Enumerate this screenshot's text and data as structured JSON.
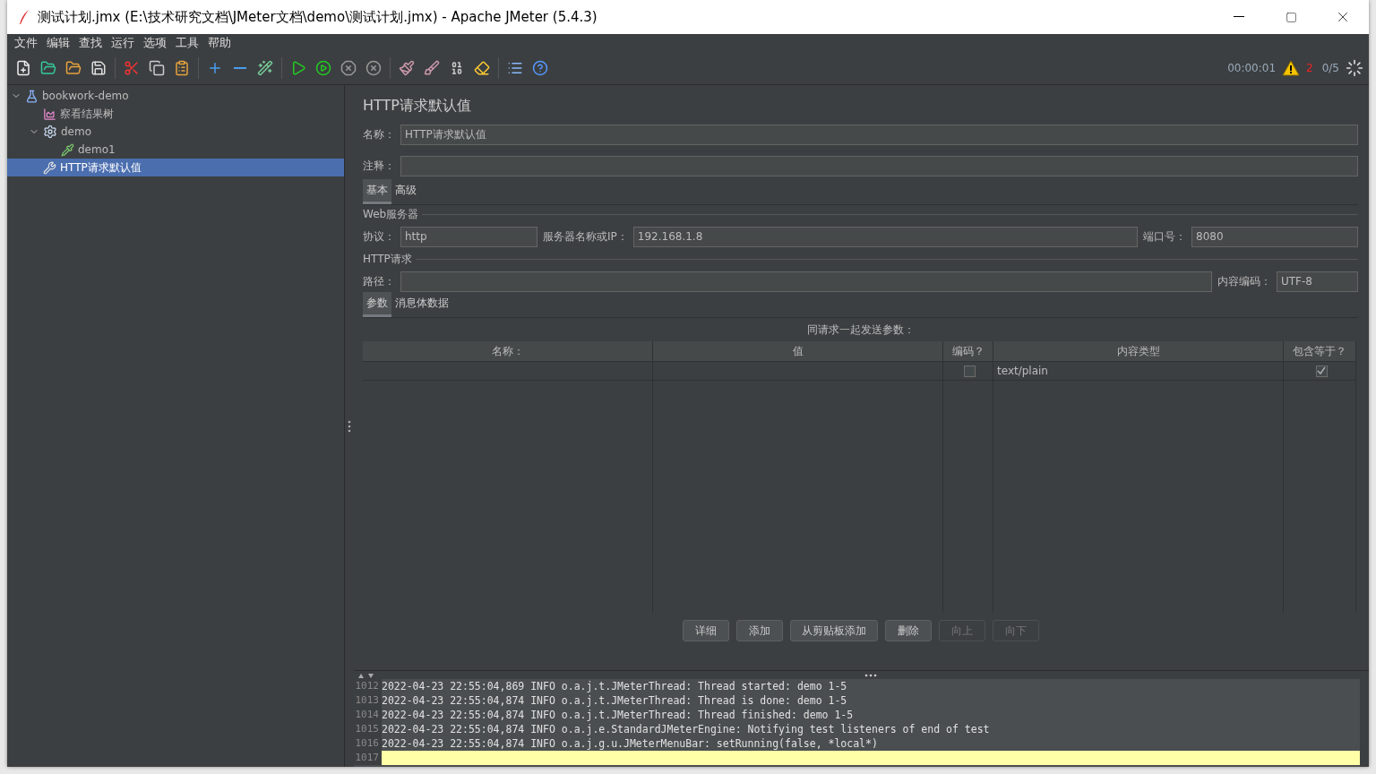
{
  "window": {
    "title": "测试计划.jmx (E:\\技术研究文档\\JMeter文档\\demo\\测试计划.jmx) - Apache JMeter (5.4.3)"
  },
  "menu": [
    "文件",
    "编辑",
    "查找",
    "运行",
    "选项",
    "工具",
    "帮助"
  ],
  "status": {
    "elapsed": "00:00:01",
    "warnings": "2",
    "threads": "0/5"
  },
  "tree": [
    {
      "label": "bookwork-demo",
      "kind": "plan",
      "expanded": true,
      "selected": false,
      "children": [
        {
          "label": "察看结果树",
          "kind": "listener",
          "selected": false
        },
        {
          "label": "demo",
          "kind": "group",
          "expanded": true,
          "selected": false,
          "children": [
            {
              "label": "demo1",
              "kind": "sampler",
              "selected": false
            }
          ]
        },
        {
          "label": "HTTP请求默认值",
          "kind": "config",
          "selected": true
        }
      ]
    }
  ],
  "panel": {
    "title": "HTTP请求默认值",
    "name_label": "名称：",
    "name_value": "HTTP请求默认值",
    "comment_label": "注释：",
    "tabs": [
      {
        "label": "基本",
        "selected": true
      },
      {
        "label": "高级",
        "selected": false
      }
    ],
    "web_server": {
      "legend": "Web服务器",
      "protocol_label": "协议：",
      "protocol": "http",
      "server_label": "服务器名称或IP：",
      "server": "192.168.1.8",
      "port_label": "端口号：",
      "port": "8080"
    },
    "http_request": {
      "legend": "HTTP请求",
      "path_label": "路径：",
      "encoding_label": "内容编码：",
      "encoding": "UTF-8"
    },
    "param_tabs": [
      {
        "label": "参数",
        "selected": true
      },
      {
        "label": "消息体数据",
        "selected": false
      }
    ],
    "table": {
      "caption": "同请求一起发送参数：",
      "columns": [
        "名称：",
        "值",
        "编码？",
        "内容类型",
        "包含等于？"
      ],
      "rows": [
        {
          "encode": false,
          "content_type": "text/plain",
          "include_equals": true
        }
      ]
    },
    "buttons": [
      {
        "label": "详细",
        "disabled": false
      },
      {
        "label": "添加",
        "disabled": false
      },
      {
        "label": "从剪贴板添加",
        "disabled": false
      },
      {
        "label": "删除",
        "disabled": false
      },
      {
        "label": "向上",
        "disabled": true
      },
      {
        "label": "向下",
        "disabled": true
      }
    ]
  },
  "log": [
    {
      "number": "1012",
      "text": "2022-04-23 22:55:04,869 INFO o.a.j.t.JMeterThread: Thread started: demo 1-5",
      "current": false
    },
    {
      "number": "1013",
      "text": "2022-04-23 22:55:04,874 INFO o.a.j.t.JMeterThread: Thread is done: demo 1-5",
      "current": false
    },
    {
      "number": "1014",
      "text": "2022-04-23 22:55:04,874 INFO o.a.j.t.JMeterThread: Thread finished: demo 1-5",
      "current": false
    },
    {
      "number": "1015",
      "text": "2022-04-23 22:55:04,874 INFO o.a.j.e.StandardJMeterEngine: Notifying test listeners of end of test",
      "current": false
    },
    {
      "number": "1016",
      "text": "2022-04-23 22:55:04,874 INFO o.a.j.g.u.JMeterMenuBar: setRunning(false, *local*)",
      "current": false
    },
    {
      "number": "1017",
      "current": true
    }
  ]
}
